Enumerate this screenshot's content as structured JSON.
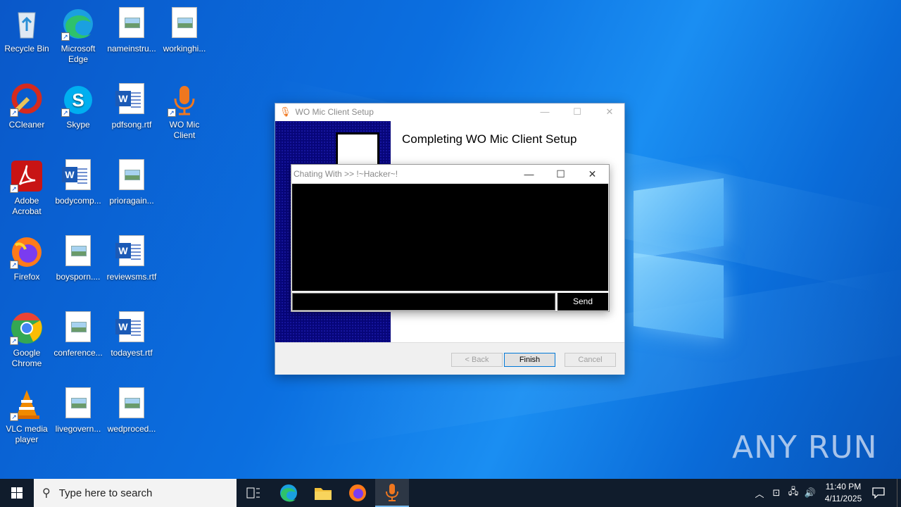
{
  "desktop": {
    "icons": [
      {
        "label": "Recycle Bin"
      },
      {
        "label": "Microsoft Edge"
      },
      {
        "label": "nameinstru..."
      },
      {
        "label": "workinghi..."
      },
      {
        "label": "CCleaner"
      },
      {
        "label": "Skype"
      },
      {
        "label": "pdfsong.rtf"
      },
      {
        "label": "WO Mic Client"
      },
      {
        "label": "Adobe Acrobat"
      },
      {
        "label": "bodycomp..."
      },
      {
        "label": "prioragain..."
      },
      {
        "label": "Firefox"
      },
      {
        "label": "boysporn...."
      },
      {
        "label": "reviewsms.rtf"
      },
      {
        "label": "Google Chrome"
      },
      {
        "label": "conference..."
      },
      {
        "label": "todayest.rtf"
      },
      {
        "label": "VLC media player"
      },
      {
        "label": "livegovern..."
      },
      {
        "label": "wedproced..."
      }
    ]
  },
  "setup_window": {
    "title": "WO Mic Client Setup",
    "heading": "Completing WO Mic Client Setup",
    "buttons": {
      "back": "< Back",
      "finish": "Finish",
      "cancel": "Cancel"
    }
  },
  "chat_window": {
    "title": "Chating With >> !~Hacker~!",
    "message_log": "",
    "input_value": "",
    "send_label": "Send"
  },
  "watermark": "ANY RUN",
  "taskbar": {
    "search_placeholder": "Type here to search",
    "pinned": [
      "task-view-icon",
      "edge-icon",
      "file-explorer-icon",
      "firefox-icon",
      "wo-mic-icon"
    ],
    "clock": {
      "time": "11:40 PM",
      "date": "4/11/2025"
    }
  },
  "colors": {
    "desktop": "#0b6fe0",
    "taskbar": "#101c2c",
    "accent": "#0078d7"
  }
}
